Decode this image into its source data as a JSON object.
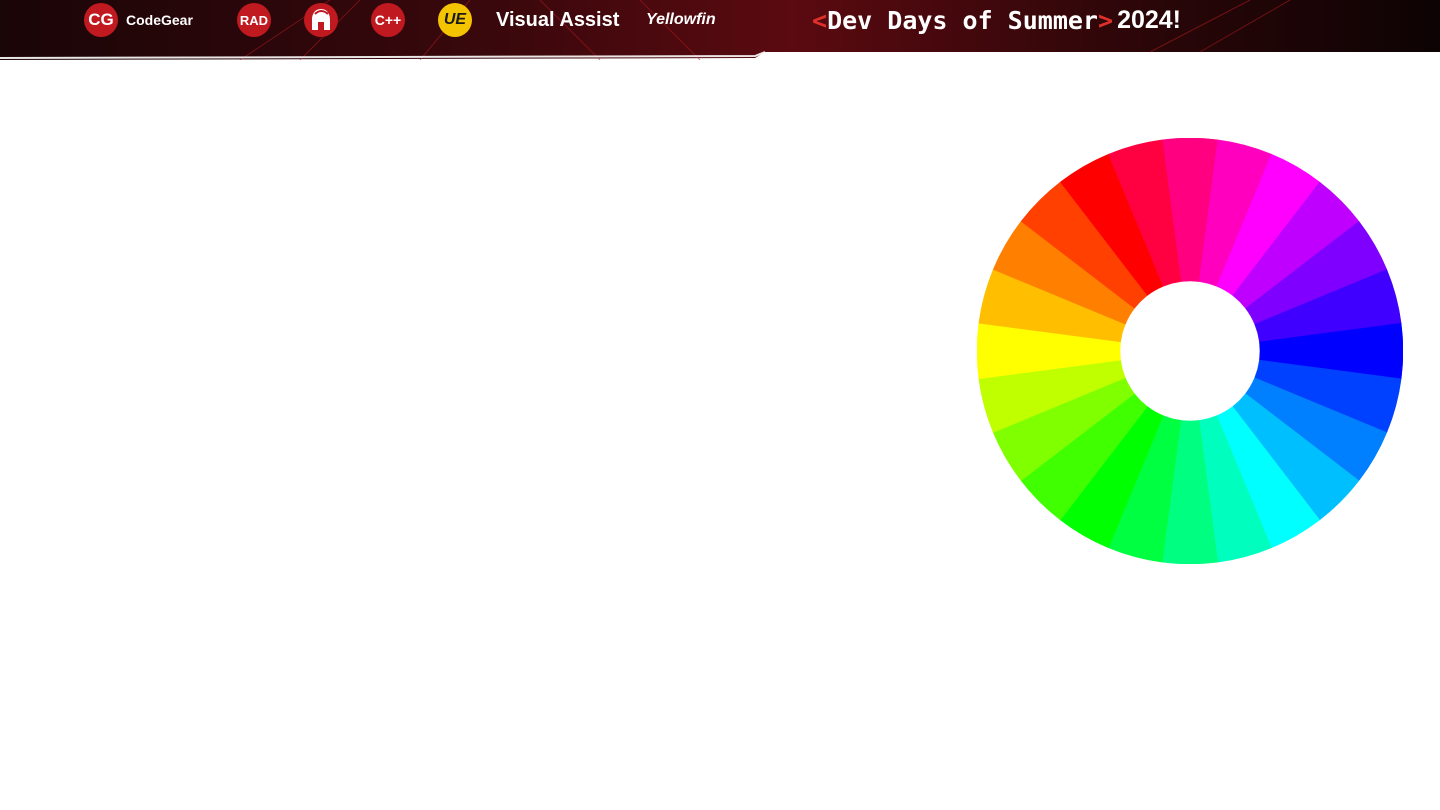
{
  "banner": {
    "codegear_badge": "CG",
    "codegear_label": "CodeGear",
    "rad_label": "RAD",
    "cpp_badge": "C++",
    "ue_badge": "UE",
    "visual_assist_label": "Visual Assist",
    "yellowfin_label": "Yellowfin",
    "event": {
      "open_bracket": "<",
      "name": "Dev Days of Summer",
      "close_bracket": ">",
      "year": "2024!"
    },
    "colors": {
      "dark": "#140405",
      "red": "#c0191f",
      "accent": "#e0302a",
      "gold": "#f5c400"
    }
  },
  "color_wheel": {
    "segments": 24,
    "colors": [
      "#ff0080",
      "#ff00bf",
      "#ff00ff",
      "#bf00ff",
      "#8000ff",
      "#4000ff",
      "#0000ff",
      "#0040ff",
      "#0080ff",
      "#00bfff",
      "#00ffff",
      "#00ffbf",
      "#00ff80",
      "#00ff40",
      "#00ff00",
      "#40ff00",
      "#80ff00",
      "#bfff00",
      "#ffff00",
      "#ffbf00",
      "#ff8000",
      "#ff4000",
      "#ff0000",
      "#ff0040"
    ]
  }
}
